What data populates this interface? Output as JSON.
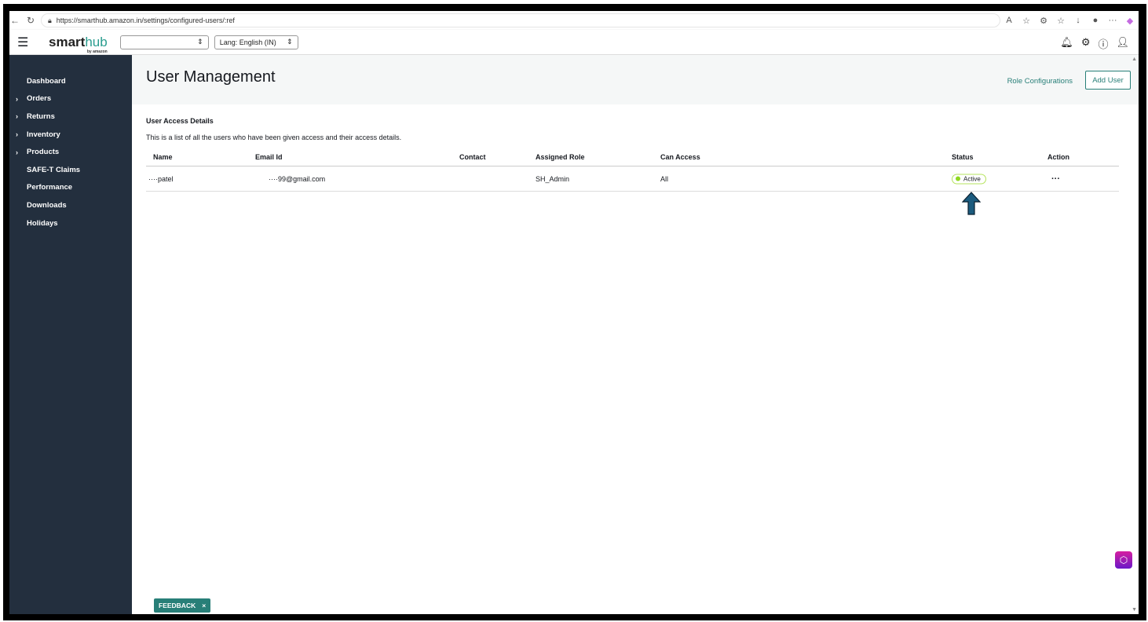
{
  "browser": {
    "url": "https://smarthub.amazon.in/settings/configured-users/:ref"
  },
  "header": {
    "logo": "smarthub",
    "logo_sub": "by amazon",
    "store_select": "",
    "lang_select": "Lang: English (IN)",
    "icons": [
      "bell-icon",
      "gear-icon",
      "help-icon",
      "user-icon"
    ]
  },
  "sidebar": {
    "items": [
      {
        "label": "Dashboard",
        "expandable": false
      },
      {
        "label": "Orders",
        "expandable": true
      },
      {
        "label": "Returns",
        "expandable": true
      },
      {
        "label": "Inventory",
        "expandable": true
      },
      {
        "label": "Products",
        "expandable": true
      },
      {
        "label": "SAFE-T Claims",
        "expandable": false
      },
      {
        "label": "Performance",
        "expandable": false
      },
      {
        "label": "Downloads",
        "expandable": false
      },
      {
        "label": "Holidays",
        "expandable": false
      }
    ]
  },
  "page": {
    "title": "User Management",
    "role_config": "Role Configurations",
    "add_user": "Add User",
    "section_title": "User Access Details",
    "section_desc": "This is a list of all the users who have been given access and their access details."
  },
  "table": {
    "columns": [
      "Name",
      "Email Id",
      "Contact",
      "Assigned Role",
      "Can Access",
      "Status",
      "Action"
    ],
    "rows": [
      {
        "name": "····patel",
        "email": "····99@gmail.com",
        "contact": "",
        "role": "SH_Admin",
        "access": "All",
        "status": "Active",
        "action": "···"
      }
    ]
  },
  "feedback": {
    "label": "FEEDBACK",
    "close": "×"
  },
  "colors": {
    "accent": "#287f78",
    "sidebar": "#232f3e",
    "active": "#8ed81f",
    "arrow": "#1b5b7e"
  }
}
